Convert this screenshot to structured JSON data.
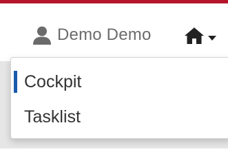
{
  "header": {
    "accent_color": "#b5152b",
    "user": {
      "icon": "user-icon",
      "name": "Demo Demo"
    },
    "home_menu": {
      "icon": "home-icon",
      "caret_icon": "caret-down-icon"
    }
  },
  "dropdown": {
    "active_indicator_color": "#1a5bab",
    "items": [
      {
        "label": "Cockpit",
        "active": true
      },
      {
        "label": "Tasklist",
        "active": false
      }
    ]
  }
}
